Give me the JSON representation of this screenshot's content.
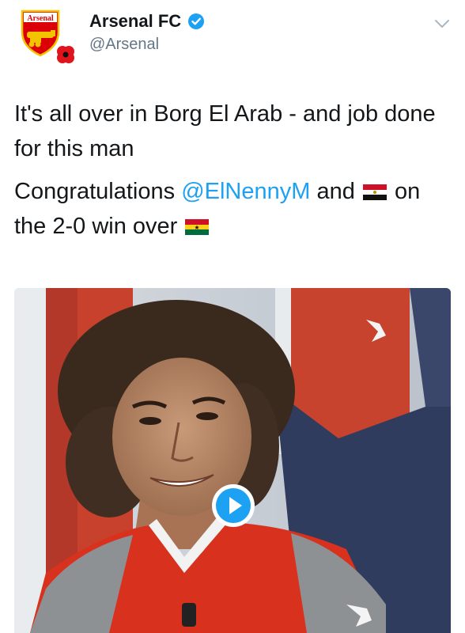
{
  "tweet": {
    "display_name": "Arsenal FC",
    "handle": "@Arsenal",
    "verified": true,
    "crest_text": "Arsenal",
    "line1": "It's all over in Borg El Arab - and job done for this man",
    "line2_start": "Congratulations ",
    "mention": "@ElNennyM",
    "line2_mid": " and ",
    "line2_after_flag": " on the 2-0 win over ",
    "flags": [
      "egypt-flag",
      "ghana-flag"
    ],
    "media_type": "video"
  },
  "colors": {
    "accent": "#1da1f2",
    "handle_gray": "#657786",
    "arsenal_red": "#db0007",
    "shirt_gray": "#8e9193"
  }
}
